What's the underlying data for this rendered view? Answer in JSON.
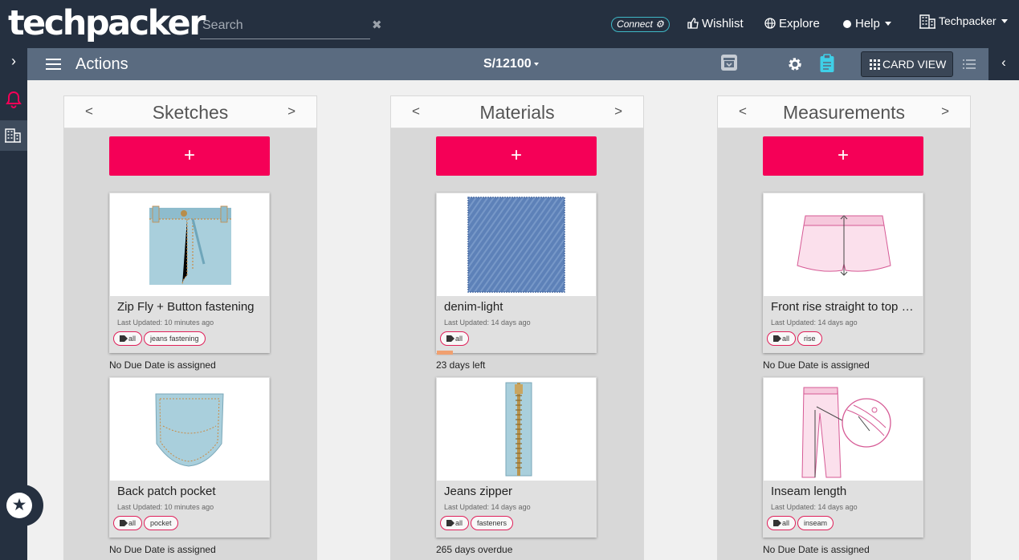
{
  "header": {
    "logo": "techpacker",
    "search_placeholder": "Search",
    "clear_icon": "✖",
    "connect_label": "Connect",
    "wishlist_label": "Wishlist",
    "explore_label": "Explore",
    "help_label": "Help",
    "account_label": "Techpacker"
  },
  "actionbar": {
    "title": "Actions",
    "style_number": "S/12100",
    "card_view_label": "CARD VIEW"
  },
  "sidebar": {
    "expand_icon": "›",
    "collapse_icon": "‹"
  },
  "columns": [
    {
      "title": "Sketches",
      "add_label": "+",
      "cards": [
        {
          "name": "Zip Fly + Button fastening",
          "updated": "Last Updated: 10 minutes ago",
          "tags": [
            "all",
            "jeans fastening"
          ],
          "due": "No Due Date is assigned"
        },
        {
          "name": "Back patch pocket",
          "updated": "Last Updated: 10 minutes ago",
          "tags": [
            "all",
            "pocket"
          ],
          "due": "No Due Date is assigned"
        }
      ]
    },
    {
      "title": "Materials",
      "add_label": "+",
      "cards": [
        {
          "name": "denim-light",
          "updated": "Last Updated: 14 days ago",
          "tags": [
            "all"
          ],
          "due": "23 days left"
        },
        {
          "name": "Jeans zipper",
          "updated": "Last Updated: 14 days ago",
          "tags": [
            "all",
            "fasteners"
          ],
          "due": "265 days overdue"
        }
      ]
    },
    {
      "title": "Measurements",
      "add_label": "+",
      "cards": [
        {
          "name": "Front rise straight to top of waistband",
          "updated": "Last Updated: 14 days ago",
          "tags": [
            "all",
            "rise"
          ],
          "due": "No Due Date is assigned"
        },
        {
          "name": "Inseam length",
          "updated": "Last Updated: 14 days ago",
          "tags": [
            "all",
            "inseam"
          ],
          "due": "No Due Date is assigned"
        }
      ]
    }
  ],
  "colors": {
    "topbar": "#253040",
    "actionbar": "#5a6b80",
    "accent_pink": "#f50057",
    "accent_cyan": "#3fd0e8"
  }
}
